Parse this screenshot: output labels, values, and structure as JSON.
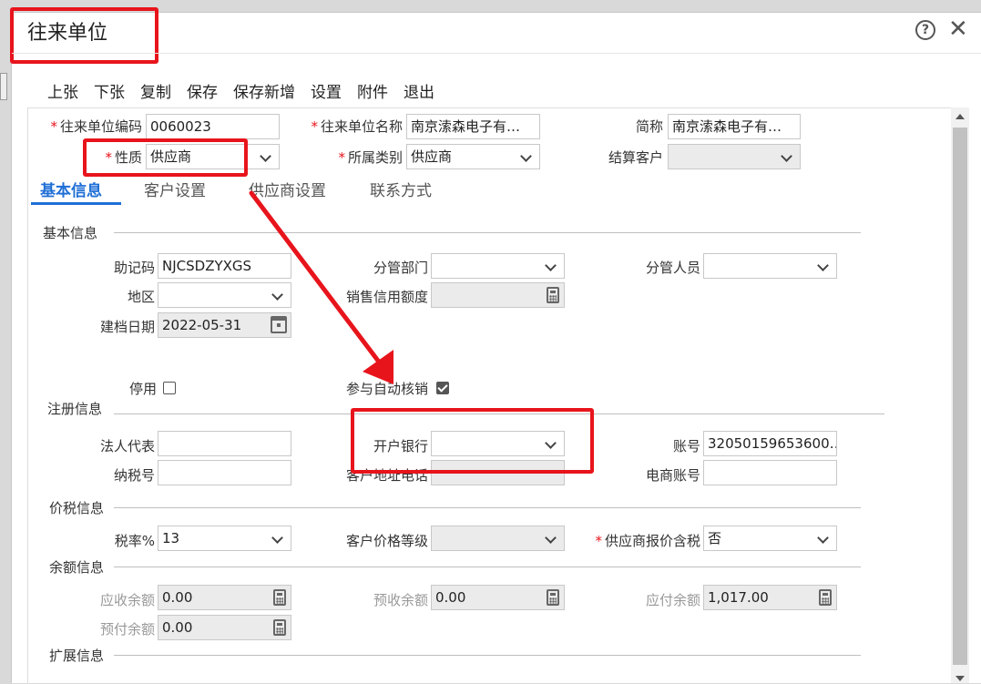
{
  "window": {
    "title": "往来单位"
  },
  "toolbar": {
    "items": [
      "上张",
      "下张",
      "复制",
      "保存",
      "保存新增",
      "设置",
      "附件",
      "退出"
    ]
  },
  "header": {
    "code_label": "往来单位编码",
    "code_value": "0060023",
    "name_label": "往来单位名称",
    "name_value": "南京溹森电子有…",
    "short_label": "简称",
    "short_value": "南京溹森电子有…",
    "nature_label": "性质",
    "nature_value": "供应商",
    "category_label": "所属类别",
    "category_value": "供应商",
    "settle_label": "结算客户",
    "settle_value": ""
  },
  "tabs": [
    "基本信息",
    "客户设置",
    "供应商设置",
    "联系方式"
  ],
  "basic": {
    "section": "基本信息",
    "mnemonic_label": "助记码",
    "mnemonic_value": "NJCSDZYXGS",
    "dept_label": "分管部门",
    "dept_value": "",
    "staff_label": "分管人员",
    "staff_value": "",
    "region_label": "地区",
    "region_value": "",
    "credit_label": "销售信用额度",
    "credit_value": "",
    "date_label": "建档日期",
    "date_value": "2022-05-31",
    "disabled_label": "停用",
    "disabled_checked": false,
    "auto_label": "参与自动核销",
    "auto_checked": true
  },
  "register": {
    "section": "注册信息",
    "legal_label": "法人代表",
    "legal_value": "",
    "bank_label": "开户银行",
    "bank_value": "",
    "account_label": "账号",
    "account_value": "32050159653600…",
    "tax_label": "纳税号",
    "tax_value": "",
    "address_label": "客户地址电话",
    "address_value": "",
    "ecom_label": "电商账号",
    "ecom_value": ""
  },
  "price": {
    "section": "价税信息",
    "rate_label": "税率%",
    "rate_value": "13",
    "level_label": "客户价格等级",
    "level_value": "",
    "incl_label": "供应商报价含税",
    "incl_value": "否"
  },
  "balance": {
    "section": "余额信息",
    "recv_label": "应收余额",
    "recv_value": "0.00",
    "prerecv_label": "预收余额",
    "prerecv_value": "0.00",
    "pay_label": "应付余额",
    "pay_value": "1,017.00",
    "prepay_label": "预付余额",
    "prepay_value": "0.00"
  },
  "ext": {
    "section": "扩展信息"
  },
  "colors": {
    "highlight": "#e8141c",
    "accent": "#1f6fd6"
  }
}
